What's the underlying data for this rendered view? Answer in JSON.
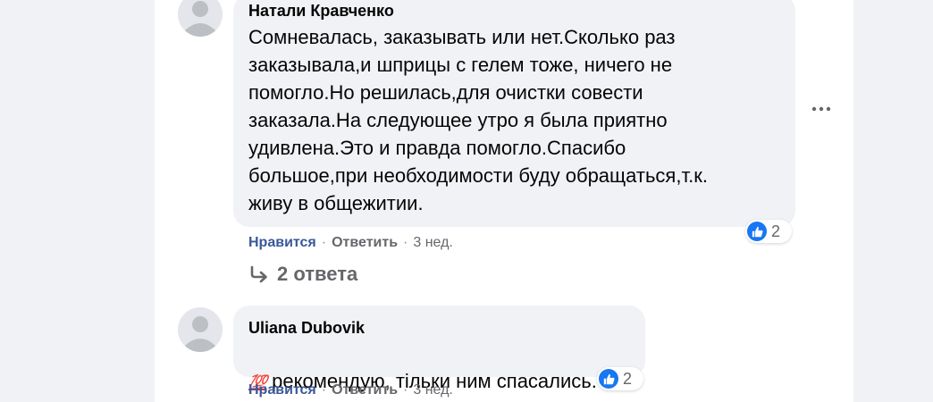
{
  "comments": [
    {
      "author": "Натали Кравченко",
      "text": "Сомневалась, заказывать или нет.Сколько раз\nзаказывала,и шприцы с гелем тоже, ничего не\nпомогло.Но решилась,для очистки совести\nзаказала.На следующее утро я была приятно\nудивлена.Это и правда помогло.Спасибо\nбольшое,при необходимости буду обращаться,т.к.\nживу в общежитии.",
      "like_label": "Нравится",
      "reply_label": "Ответить",
      "time": "3 нед.",
      "reaction_icon": "like-icon",
      "reaction_count": "2",
      "replies_label": "2 ответа"
    },
    {
      "author": "Uliana Dubovik",
      "emoji": "💯",
      "text": "рекомендую, тільки ним спасались.",
      "like_label": "Нравится",
      "reply_label": "Ответить",
      "time": "3 нед.",
      "reaction_icon": "like-icon",
      "reaction_count": "2"
    }
  ],
  "separator": "·",
  "more_icon": "more-options-icon",
  "colors": {
    "page_bg": "#f0f2f5",
    "bubble_bg": "#f0f2f5",
    "link_blue": "#385898",
    "like_blue": "#1877f2",
    "meta_gray": "#65676b"
  }
}
